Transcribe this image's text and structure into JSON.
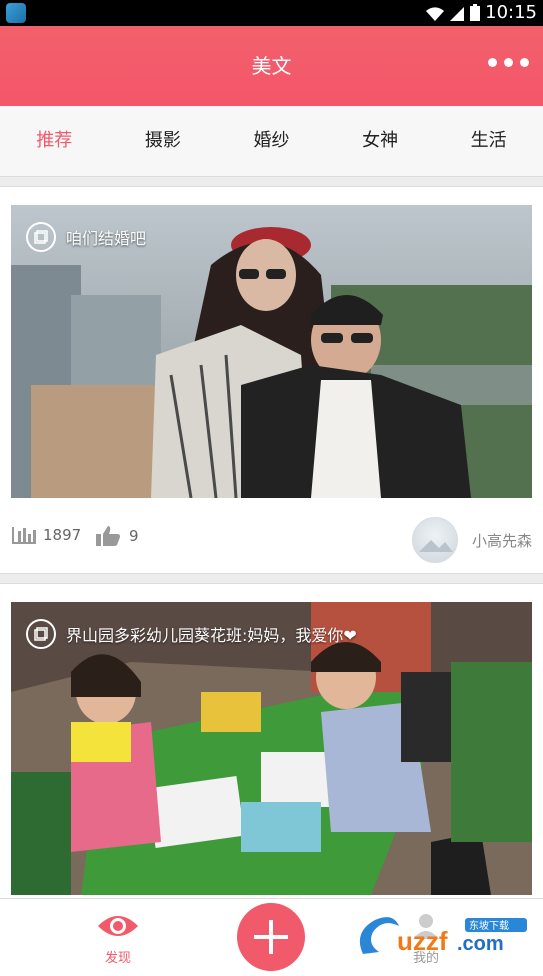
{
  "status_bar": {
    "time": "10:15"
  },
  "header": {
    "title": "美文",
    "accent_color": "#f4556a",
    "more_icon": "more-dots-icon"
  },
  "tabs": [
    {
      "label": "推荐",
      "active": true
    },
    {
      "label": "摄影",
      "active": false
    },
    {
      "label": "婚纱",
      "active": false
    },
    {
      "label": "女神",
      "active": false
    },
    {
      "label": "生活",
      "active": false
    }
  ],
  "feed": [
    {
      "caption": "咱们结婚吧",
      "views": "1897",
      "likes": "9",
      "author": "小高先森"
    },
    {
      "caption": "界山园多彩幼儿园葵花班:妈妈，我爱你❤"
    }
  ],
  "bottom_nav": {
    "discover_label": "发现",
    "mine_label": "我的",
    "add_icon": "plus-icon"
  },
  "watermark": {
    "text": "uzzf.com",
    "subtext": "东坡下载"
  }
}
